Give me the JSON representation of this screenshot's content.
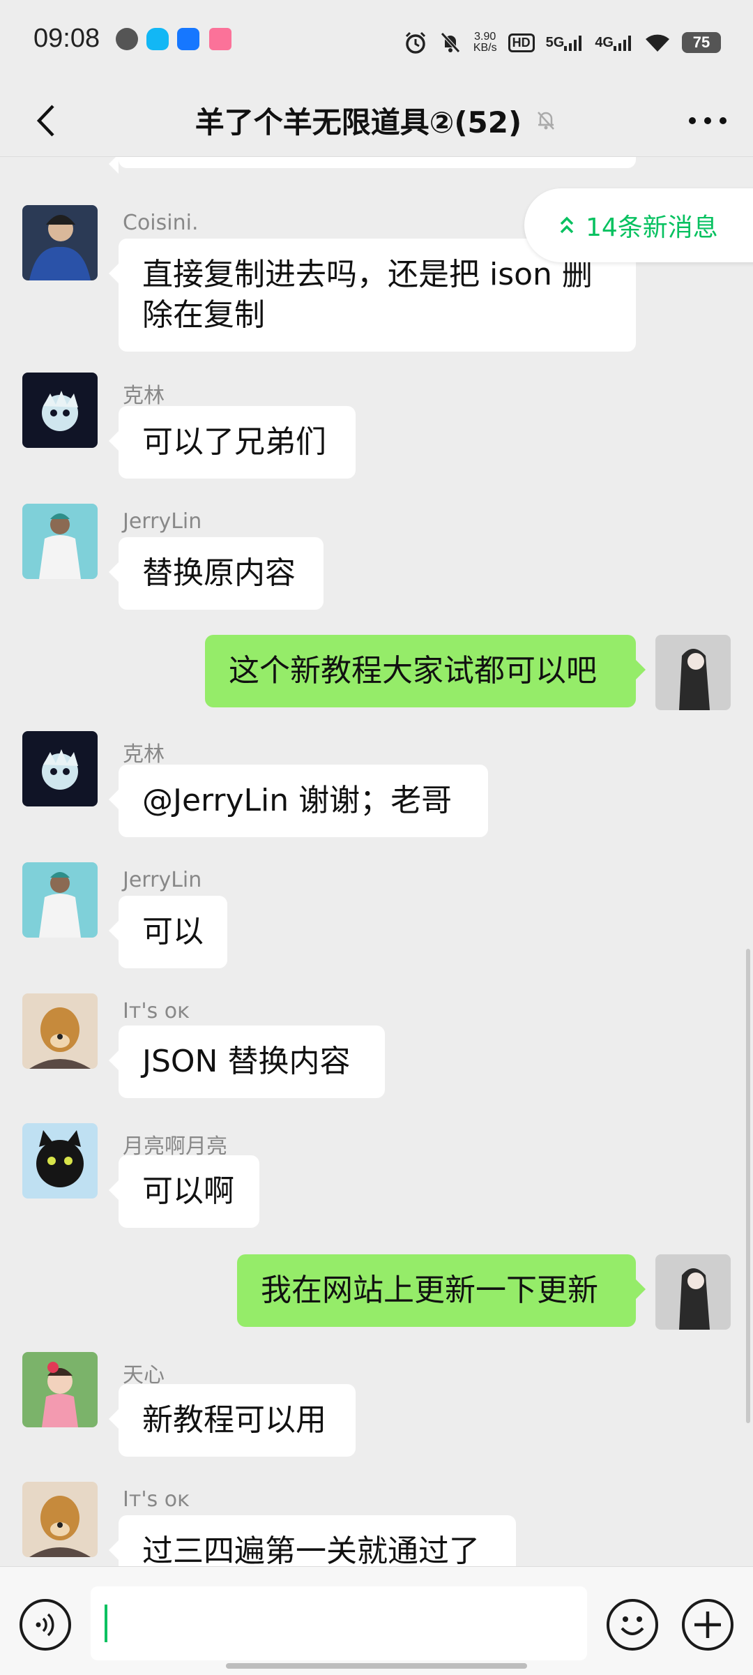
{
  "status_bar": {
    "time": "09:08",
    "speed_value": "3.90",
    "speed_unit": "KB/s",
    "hd": "HD",
    "net1": "5G",
    "net2": "4G",
    "battery": "75",
    "app_icons": [
      "speedometer-icon",
      "qq-icon",
      "browser-icon",
      "bilibili-icon"
    ]
  },
  "header": {
    "title": "羊了个羊无限道具②(52)",
    "icons": {
      "back": "chevron-left-icon",
      "mute": "bell-off-icon",
      "more": "more-dots-icon"
    }
  },
  "new_messages_badge": {
    "label": "14条新消息",
    "icon": "double-chevron-up-icon"
  },
  "messages": [
    {
      "side": "left",
      "sender": "Coisini.",
      "text": "直接复制进去吗，还是把 ison 删除在复制",
      "avatar": "avatar-coisini"
    },
    {
      "side": "left",
      "sender": "克林",
      "text": "可以了兄弟们",
      "avatar": "avatar-kelin"
    },
    {
      "side": "left",
      "sender": "JerryLin",
      "text": "替换原内容",
      "avatar": "avatar-jerrylin"
    },
    {
      "side": "right",
      "sender": "",
      "text": "这个新教程大家试都可以吧",
      "avatar": "avatar-me"
    },
    {
      "side": "left",
      "sender": "克林",
      "text": "@JerryLin  谢谢；老哥",
      "avatar": "avatar-kelin"
    },
    {
      "side": "left",
      "sender": "JerryLin",
      "text": "可以",
      "avatar": "avatar-jerrylin"
    },
    {
      "side": "left",
      "sender": "Iт's ᴏᴋ",
      "text": "JSON 替换内容",
      "avatar": "avatar-its-ok"
    },
    {
      "side": "left",
      "sender": "月亮啊月亮",
      "text": "可以啊",
      "avatar": "avatar-moon"
    },
    {
      "side": "right",
      "sender": "",
      "text": "我在网站上更新一下更新",
      "avatar": "avatar-me"
    },
    {
      "side": "left",
      "sender": "天心",
      "text": "新教程可以用",
      "avatar": "avatar-tianxin"
    },
    {
      "side": "left",
      "sender": "Iт's ᴏᴋ",
      "text": "过三四遍第一关就通过了",
      "avatar": "avatar-its-ok"
    }
  ],
  "input_bar": {
    "text_value": "",
    "icons": {
      "voice": "voice-icon",
      "emoji": "emoji-icon",
      "plus": "plus-icon"
    }
  },
  "colors": {
    "background": "#ededed",
    "my_bubble": "#95ec69",
    "other_bubble": "#ffffff",
    "accent": "#07c160"
  }
}
